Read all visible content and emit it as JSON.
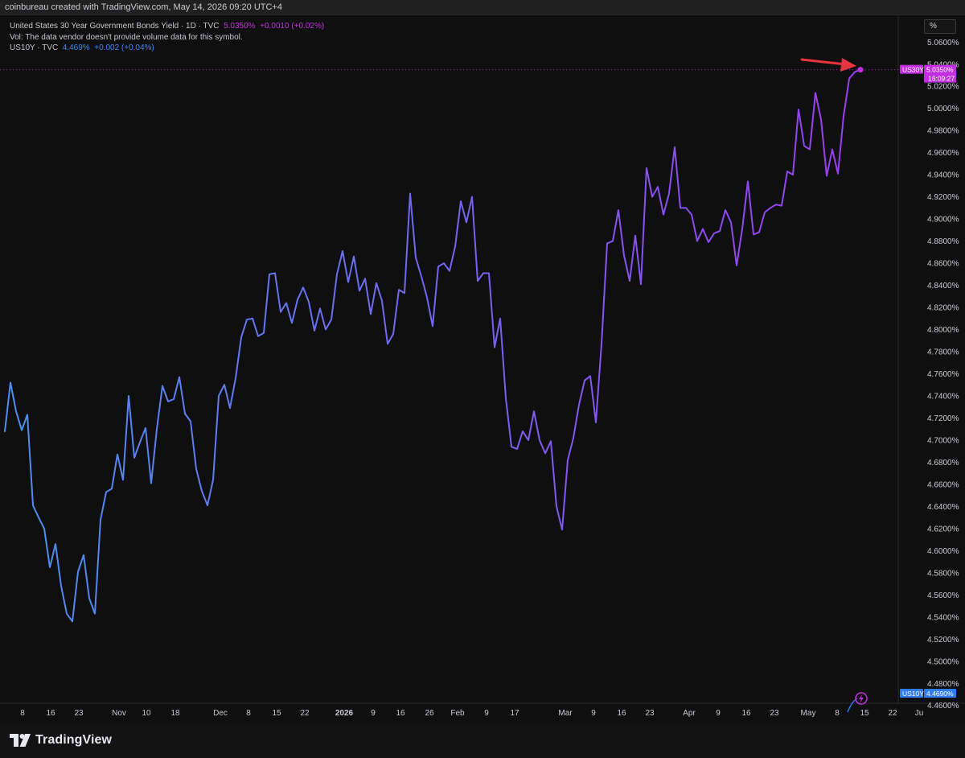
{
  "header": {
    "attribution": "coinbureau created with TradingView.com, May 14, 2026 09:20 UTC+4"
  },
  "legend": {
    "main_symbol": "United States 30 Year Government Bonds Yield · 1D · TVC",
    "main_price": "5.0350%",
    "main_change": "+0.0010 (+0.02%)",
    "vol_note": "Vol: The data vendor doesn't provide volume data for this symbol.",
    "compare_symbol": "US10Y · TVC",
    "compare_price": "4.469%",
    "compare_change": "+0.002 (+0.04%)"
  },
  "scale_mode_label": "%",
  "price_tags": {
    "us30y_ticker": "US30Y",
    "us30y_value": "5.0350%",
    "countdown": "16:09:27",
    "us10y_ticker": "US10Y",
    "us10y_value": "4.4690%"
  },
  "footer": {
    "brand": "TradingView"
  },
  "colors": {
    "background": "#0f0f0f",
    "us30y": "#c22fe0",
    "us10y": "#2f7bf0",
    "line_start": "#4c8ff0",
    "line_end": "#9b3df0",
    "arrow": "#e8343f"
  },
  "chart_data": {
    "type": "line",
    "title": "United States 30 Year Government Bonds Yield · 1D · TVC",
    "xlabel": "",
    "ylabel": "",
    "y_unit": "%",
    "ylim": [
      4.462,
      5.0682
    ],
    "grid": false,
    "y_ticks": [
      "5.0600%",
      "5.0400%",
      "5.0200%",
      "5.0000%",
      "4.9800%",
      "4.9600%",
      "4.9400%",
      "4.9200%",
      "4.9000%",
      "4.8800%",
      "4.8600%",
      "4.8400%",
      "4.8200%",
      "4.8000%",
      "4.7800%",
      "4.7600%",
      "4.7400%",
      "4.7200%",
      "4.7000%",
      "4.6800%",
      "4.6600%",
      "4.6400%",
      "4.6200%",
      "4.6000%",
      "4.5800%",
      "4.5600%",
      "4.5400%",
      "4.5200%",
      "4.5000%",
      "4.4800%",
      "4.4600%"
    ],
    "x_ticks": [
      "8",
      "16",
      "23",
      "Nov",
      "10",
      "18",
      "Dec",
      "8",
      "15",
      "22",
      "2026",
      "9",
      "16",
      "26",
      "Feb",
      "9",
      "17",
      "Mar",
      "9",
      "16",
      "23",
      "Apr",
      "9",
      "16",
      "23",
      "May",
      "8",
      "15",
      "22",
      "Ju"
    ],
    "series": [
      {
        "name": "US30Y",
        "values": [
          4.708,
          4.752,
          4.726,
          4.709,
          4.723,
          4.641,
          4.63,
          4.62,
          4.585,
          4.606,
          4.568,
          4.543,
          4.536,
          4.581,
          4.596,
          4.557,
          4.543,
          4.628,
          4.653,
          4.656,
          4.687,
          4.664,
          4.74,
          4.684,
          4.698,
          4.711,
          4.661,
          4.71,
          4.749,
          4.735,
          4.737,
          4.757,
          4.724,
          4.717,
          4.674,
          4.654,
          4.641,
          4.664,
          4.74,
          4.75,
          4.729,
          4.756,
          4.793,
          4.809,
          4.81,
          4.794,
          4.797,
          4.85,
          4.851,
          4.816,
          4.824,
          4.806,
          4.827,
          4.838,
          4.825,
          4.799,
          4.819,
          4.8,
          4.809,
          4.85,
          4.871,
          4.843,
          4.866,
          4.835,
          4.846,
          4.814,
          4.842,
          4.826,
          4.787,
          4.796,
          4.836,
          4.833,
          4.923,
          4.865,
          4.848,
          4.829,
          4.803,
          4.857,
          4.86,
          4.853,
          4.875,
          4.916,
          4.897,
          4.92,
          4.844,
          4.851,
          4.851,
          4.784,
          4.81,
          4.738,
          4.694,
          4.692,
          4.708,
          4.7,
          4.726,
          4.7,
          4.688,
          4.699,
          4.64,
          4.619,
          4.682,
          4.702,
          4.732,
          4.754,
          4.758,
          4.716,
          4.787,
          4.878,
          4.88,
          4.908,
          4.867,
          4.844,
          4.885,
          4.841,
          4.946,
          4.92,
          4.929,
          4.904,
          4.923,
          4.965,
          4.91,
          4.91,
          4.904,
          4.88,
          4.891,
          4.879,
          4.887,
          4.889,
          4.908,
          4.897,
          4.858,
          4.891,
          4.934,
          4.886,
          4.888,
          4.906,
          4.91,
          4.913,
          4.912,
          4.943,
          4.94,
          4.999,
          4.966,
          4.963,
          5.014,
          4.99,
          4.939,
          4.963,
          4.941,
          4.993,
          5.027,
          5.033,
          5.035
        ]
      }
    ],
    "annotations": [
      "red arrow pointing to last US30Y value",
      "US10Y last value 4.4690%"
    ]
  }
}
